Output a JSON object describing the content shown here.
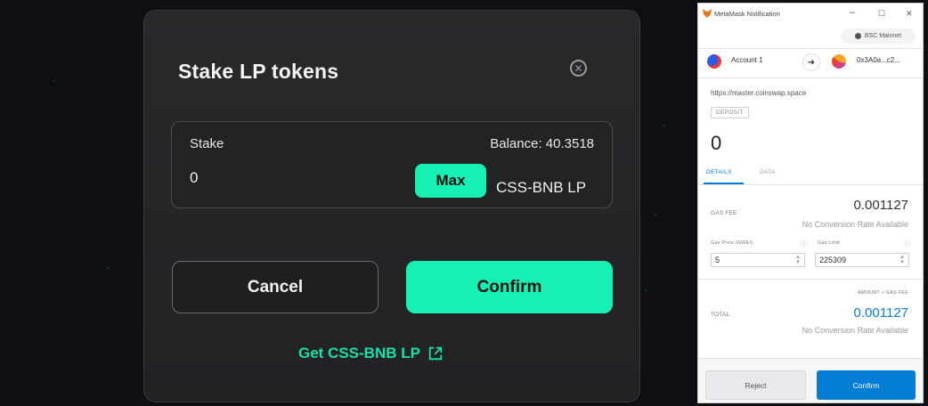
{
  "stake_modal": {
    "title": "Stake LP tokens",
    "stake_label": "Stake",
    "balance_text": "Balance: 40.3518",
    "stake_value": "0",
    "max_label": "Max",
    "token_label": "CSS-BNB LP",
    "cancel_label": "Cancel",
    "confirm_label": "Confirm",
    "get_link_label": "Get CSS-BNB LP",
    "accent_color": "#17f0b3"
  },
  "metamask": {
    "window_title": "MetaMask Notification",
    "window_controls": {
      "minimize": "–",
      "maximize": "☐",
      "close": "✕"
    },
    "network": "BSC Mainnet",
    "from_account": "Account 1",
    "to_address": "0x3A0a...c2...",
    "origin_url": "https://master.coinswap.space",
    "method": "DEPOSIT",
    "amount": "0",
    "tabs": [
      "DETAILS",
      "DATA"
    ],
    "gas_fee_label": "GAS FEE",
    "gas_fee_value": "0.001127",
    "no_conversion": "No Conversion Rate Available",
    "gas_price_label": "Gas Price (GWEI)",
    "gas_price_value": "5",
    "gas_limit_label": "Gas Limit",
    "gas_limit_value": "225309",
    "amount_gas_label": "AMOUNT + GAS FEE",
    "total_label": "TOTAL",
    "total_value": "0.001127",
    "reject_label": "Reject",
    "confirm_label": "Confirm",
    "accent_color": "#037dd6"
  }
}
